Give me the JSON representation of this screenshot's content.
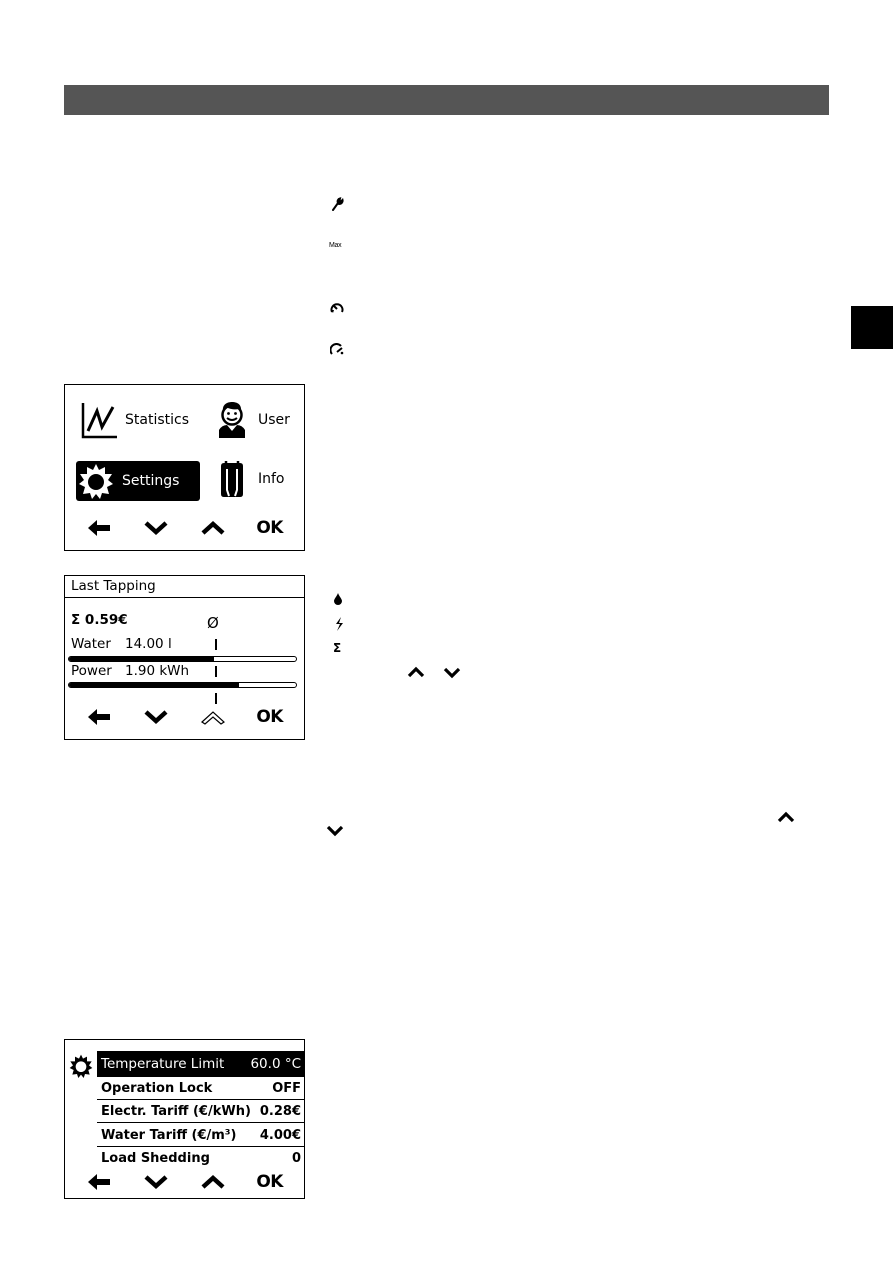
{
  "page": {
    "section_header_color": "#555555",
    "side_tab_color": "#000000"
  },
  "inline_icons": [
    {
      "name": "wrench-icon"
    },
    {
      "name": "max-label",
      "text": "Max"
    },
    {
      "name": "reset-dial-icon"
    },
    {
      "name": "speed-gauge-icon"
    }
  ],
  "main_menu": {
    "items": [
      {
        "label": "Statistics",
        "icon": "statistics-chart-icon",
        "selected": false
      },
      {
        "label": "User",
        "icon": "user-face-icon",
        "selected": false
      },
      {
        "label": "Settings",
        "icon": "gear-icon",
        "selected": true
      },
      {
        "label": "Info",
        "icon": "info-heater-icon",
        "selected": false
      }
    ],
    "nav": {
      "back": "arrow-left-icon",
      "down": "chevron-down-icon",
      "up": "chevron-up-icon",
      "ok_label": "OK"
    }
  },
  "last_tapping": {
    "title": "Last Tapping",
    "sum_label": "Σ 0.59€",
    "avg_symbol": "Ø",
    "water": {
      "label": "Water",
      "value": "14.00 l",
      "fill_percent": 64
    },
    "power": {
      "label": "Power",
      "value": "1.90 kWh",
      "fill_percent": 75
    },
    "nav": {
      "back": "arrow-left-icon",
      "down": "chevron-down-icon",
      "up": "chevron-up-outline-icon",
      "ok_label": "OK"
    }
  },
  "legend_icons": [
    {
      "name": "water-drop-icon"
    },
    {
      "name": "lightning-icon"
    },
    {
      "name": "sigma-icon",
      "text": "Σ"
    }
  ],
  "settings_menu": {
    "rows": [
      {
        "label": "Temperature Limit",
        "value": "60.0 °C",
        "selected": true
      },
      {
        "label": "Operation Lock",
        "value": "OFF",
        "selected": false
      },
      {
        "label": "Electr. Tariff (€/kWh)",
        "value": "0.28€",
        "selected": false
      },
      {
        "label": "Water Tariff (€/m³)",
        "value": "4.00€",
        "selected": false
      },
      {
        "label": "Load Shedding",
        "value": "0",
        "selected": false
      }
    ],
    "nav": {
      "back": "arrow-left-icon",
      "down": "chevron-down-icon",
      "up": "chevron-up-icon",
      "ok_label": "OK"
    }
  }
}
